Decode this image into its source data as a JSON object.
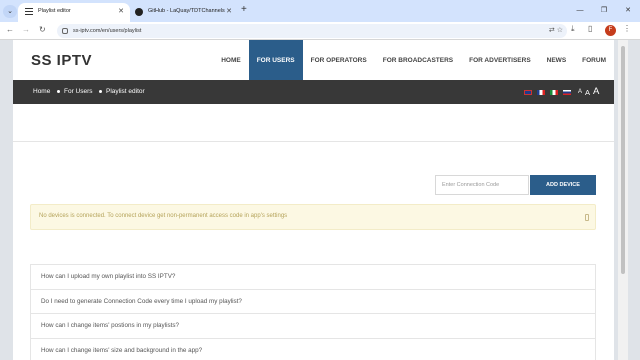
{
  "browser": {
    "tabs": [
      {
        "title": "Playlist editor",
        "icon": "list-icon"
      },
      {
        "title": "GitHub - LaQuay/TDTChannels",
        "icon": "github-icon"
      }
    ],
    "url": "ss-iptv.com/en/users/playlist"
  },
  "site": {
    "logo": "SS IPTV",
    "nav": [
      "HOME",
      "FOR USERS",
      "FOR OPERATORS",
      "FOR BROADCASTERS",
      "FOR ADVERTISERS",
      "NEWS",
      "FORUM"
    ],
    "breadcrumb": [
      "Home",
      "For Users",
      "Playlist editor"
    ],
    "font_sizes": [
      "A",
      "A",
      "A"
    ]
  },
  "connection": {
    "placeholder": "Enter Connection Code",
    "button": "ADD DEVICE"
  },
  "alert": {
    "text": "No devices is connected. To connect device get non-permanent access code in app's settings"
  },
  "faq": [
    "How can I upload my own playlist into SS IPTV?",
    "Do I need to generate Connection Code every time I upload my playlist?",
    "How can I change items' postions in my playlists?",
    "How can I change items' size and background in the app?"
  ],
  "colors": {
    "accent": "#2b5d8a",
    "breadcrumb_bg": "#383838",
    "alert_bg": "#fcf8e3"
  }
}
